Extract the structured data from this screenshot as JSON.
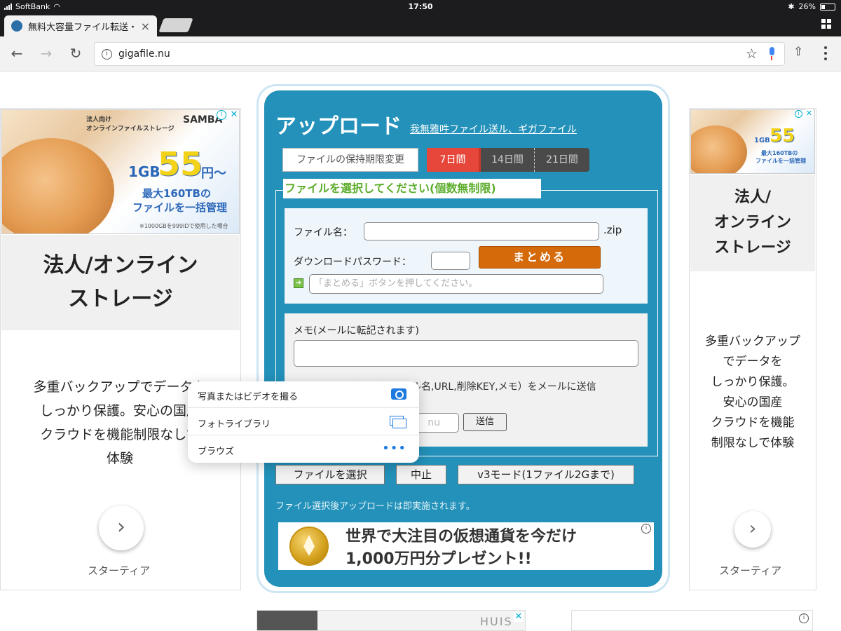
{
  "status": {
    "carrier": "SoftBank",
    "time": "17:50",
    "battery": "26%"
  },
  "tab": {
    "title": "無料大容量ファイル転送・",
    "close": "×"
  },
  "toolbar": {
    "back": "←",
    "forward": "→",
    "reload": "↻",
    "url": "gigafile.nu",
    "star": "☆",
    "share": "⇧"
  },
  "left_ad": {
    "banner_small": "法人向け\nオンラインファイルストレージ",
    "banner_brand": "SAMBA",
    "banner_1gb": "1GB",
    "banner_55": "55",
    "banner_yen": "円～",
    "banner_line1": "最大160TBの",
    "banner_line2": "ファイルを一括管理",
    "banner_note": "※1000GBを999IDで使用した場合",
    "headline_line1": "法人/オンライン",
    "headline_line2": "ストレージ",
    "body": [
      "多重バックアップでデータを",
      "しっかり保護。安心の国産",
      "クラウドを機能制限なしで",
      "体験"
    ],
    "brand": "スターティア"
  },
  "right_ad": {
    "headline": [
      "法人/",
      "オンライン",
      "ストレージ"
    ],
    "body": [
      "多重バックアップ",
      "でデータを",
      "しっかり保護。",
      "安心の国産",
      "クラウドを機能",
      "制限なしで体験"
    ],
    "brand": "スターティア"
  },
  "upload": {
    "title": "アップロード",
    "subtitle": "我無雅吽ファイル送ル、ギガファイル",
    "retention_button": "ファイルの保持期限変更",
    "days": [
      "7日間",
      "14日間",
      "21日間"
    ],
    "legend": "ファイルを選択してください(個数無制限)",
    "filename_label": "ファイル名：",
    "zip_suffix": ".zip",
    "password_label": "ダウンロードパスワード：",
    "matome_button": "まとめる",
    "matome_placeholder": "「まとめる」ボタンを押してください。",
    "memo_label": "メモ(メールに転記されます)",
    "mail_info": "アップロード情報（ファイル名,URL,削除KEY,メモ）をメールに送信",
    "mail_partial": "nu",
    "send_button": "送信",
    "select_button": "ファイルを選択",
    "stop_button": "中止",
    "v3_button": "v3モード(1ファイル2Gまで)",
    "note": "ファイル選択後アップロードは即実施されます。",
    "crypto_line1": "世界で大注目の仮想通貨を今だけ",
    "crypto_line2": "1,000万円分プレゼント!!"
  },
  "popover": {
    "items": [
      {
        "label": "写真またはビデオを撮る",
        "icon": "camera-icon"
      },
      {
        "label": "フォトライブラリ",
        "icon": "photo-library-icon"
      },
      {
        "label": "ブラウズ",
        "icon": "more-dots-icon"
      }
    ]
  },
  "bottom": {
    "huis": "HUIS"
  },
  "colors": {
    "panel": "#2391b9",
    "seven_day": "#e6473a",
    "matome": "#d56a0a",
    "legend_text": "#5cad2c",
    "ios_blue": "#1f7ae0"
  }
}
